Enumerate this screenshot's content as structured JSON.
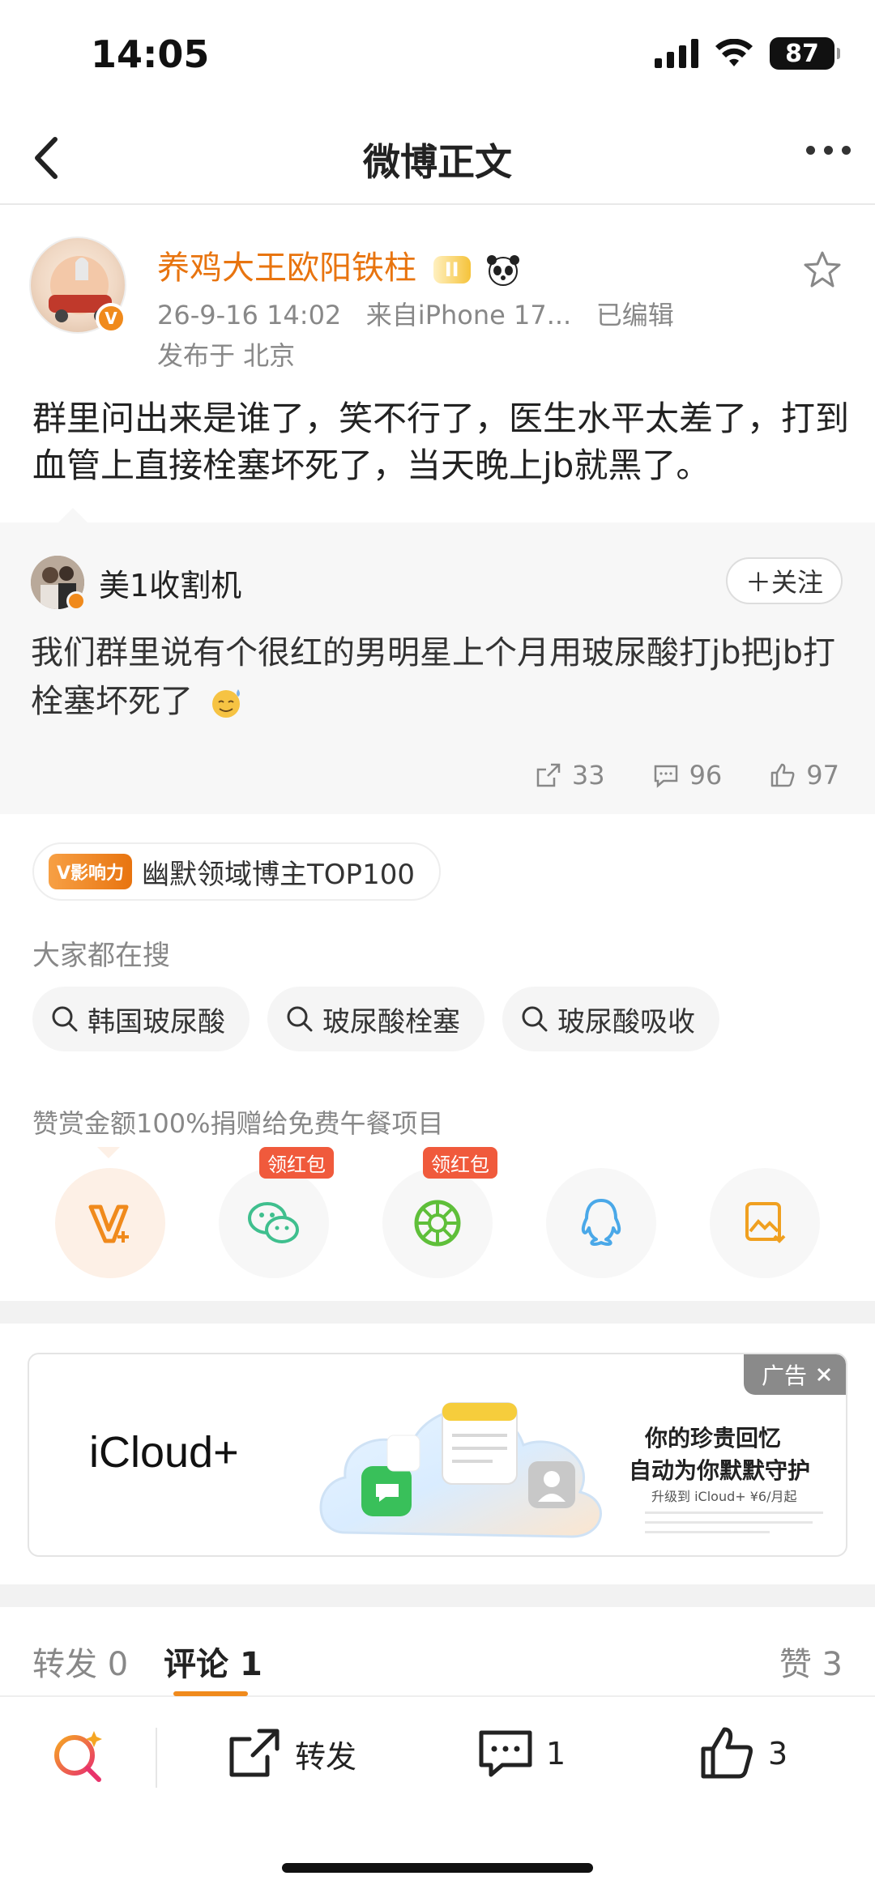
{
  "status_bar": {
    "time": "14:05",
    "battery": "87"
  },
  "nav": {
    "title": "微博正文"
  },
  "post": {
    "author": "养鸡大王欧阳铁柱",
    "author_badge": "II",
    "timestamp": "26-9-16 14:02",
    "source": "来自iPhone 17...",
    "edited": "已编辑",
    "location": "发布于 北京",
    "text": "群里问出来是谁了，笑不行了，医生水平太差了，打到血管上直接栓塞坏死了，当天晚上jb就黑了。"
  },
  "repost": {
    "author": "美1收割机",
    "follow_label": "＋关注",
    "text": "我们群里说有个很红的男明星上个月用玻尿酸打jb把jb打栓塞坏死了",
    "shares": "33",
    "comments": "96",
    "likes": "97"
  },
  "influence_tag": {
    "badge": "V影响力",
    "label": "幽默领域博主TOP100"
  },
  "hot_search": {
    "title": "大家都在搜",
    "items": [
      "韩国玻尿酸",
      "玻尿酸栓塞",
      "玻尿酸吸收"
    ]
  },
  "donation": {
    "text": "赞赏金额100%捐赠给免费午餐项目"
  },
  "share_targets": {
    "items": [
      {
        "icon": "vplus-icon",
        "tag": ""
      },
      {
        "icon": "wechat-icon",
        "tag": "领红包"
      },
      {
        "icon": "moments-icon",
        "tag": "领红包"
      },
      {
        "icon": "qq-icon",
        "tag": ""
      },
      {
        "icon": "save-image-icon",
        "tag": ""
      }
    ]
  },
  "ad": {
    "tag": "广告",
    "brand": "iCloud+",
    "line1": "你的珍贵回忆",
    "line2": "自动为你默默守护",
    "line3": "升级到 iCloud+ ¥6/月起"
  },
  "tabs": {
    "repost_label": "转发",
    "repost_count": "0",
    "comment_label": "评论",
    "comment_count": "1",
    "like_label": "赞",
    "like_count": "3"
  },
  "bottom_bar": {
    "repost_label": "转发",
    "comment_count": "1",
    "like_count": "3"
  },
  "colors": {
    "accent": "#f08a1c",
    "username": "#e8740f",
    "red_tag": "#f05a3c"
  }
}
